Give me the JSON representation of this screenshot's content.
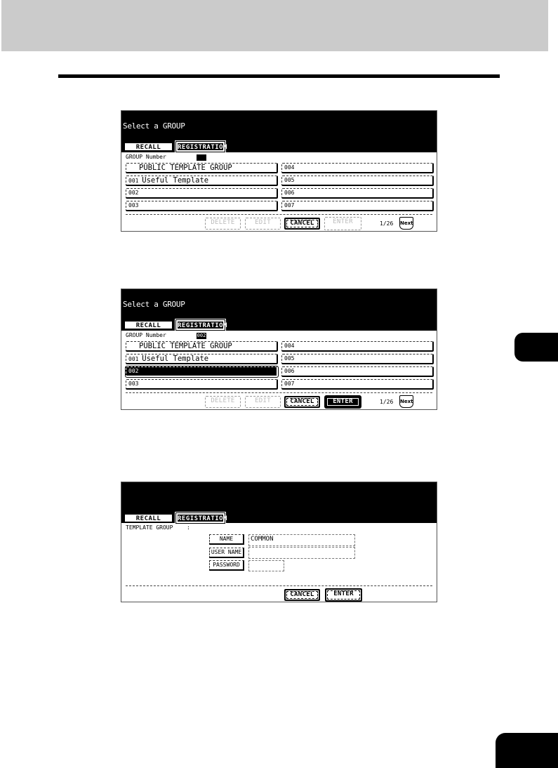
{
  "screens": [
    {
      "title": "Select a GROUP",
      "tabs": {
        "recall": "RECALL",
        "registration": "REGISTRATION"
      },
      "group_number_label": "GROUP Number",
      "group_number_value": "",
      "groups_left": [
        {
          "number": "",
          "name": "PUBLIC TEMPLATE GROUP"
        },
        {
          "number": "001",
          "name": "Useful Template"
        },
        {
          "number": "002",
          "name": ""
        },
        {
          "number": "003",
          "name": ""
        }
      ],
      "groups_right": [
        {
          "number": "004",
          "name": ""
        },
        {
          "number": "005",
          "name": ""
        },
        {
          "number": "006",
          "name": ""
        },
        {
          "number": "007",
          "name": ""
        }
      ],
      "selected_group": "",
      "buttons": {
        "delete": "DELETE",
        "edit": "EDIT",
        "cancel": "CANCEL",
        "enter": "ENTER"
      },
      "page_indicator": "1/26",
      "next_label": "Next"
    },
    {
      "title": "Select a GROUP",
      "tabs": {
        "recall": "RECALL",
        "registration": "REGISTRATION"
      },
      "group_number_label": "GROUP Number",
      "group_number_value": "002",
      "groups_left": [
        {
          "number": "",
          "name": "PUBLIC TEMPLATE GROUP"
        },
        {
          "number": "001",
          "name": "Useful Template"
        },
        {
          "number": "002",
          "name": ""
        },
        {
          "number": "003",
          "name": ""
        }
      ],
      "groups_right": [
        {
          "number": "004",
          "name": ""
        },
        {
          "number": "005",
          "name": ""
        },
        {
          "number": "006",
          "name": ""
        },
        {
          "number": "007",
          "name": ""
        }
      ],
      "selected_group": "002",
      "buttons": {
        "delete": "DELETE",
        "edit": "EDIT",
        "cancel": "CANCEL",
        "enter": "ENTER"
      },
      "page_indicator": "1/26",
      "next_label": "Next"
    },
    {
      "tabs": {
        "recall": "RECALL",
        "registration": "REGISTRATION"
      },
      "template_group_label": "TEMPLATE GROUP",
      "template_group_sep": ":",
      "fields": {
        "name": {
          "label": "NAME",
          "value": "COMMON"
        },
        "user_name": {
          "label": "USER NAME",
          "value": ""
        },
        "password": {
          "label": "PASSWORD",
          "value": ""
        }
      },
      "buttons": {
        "cancel": "CANCEL",
        "enter": "ENTER"
      }
    }
  ]
}
